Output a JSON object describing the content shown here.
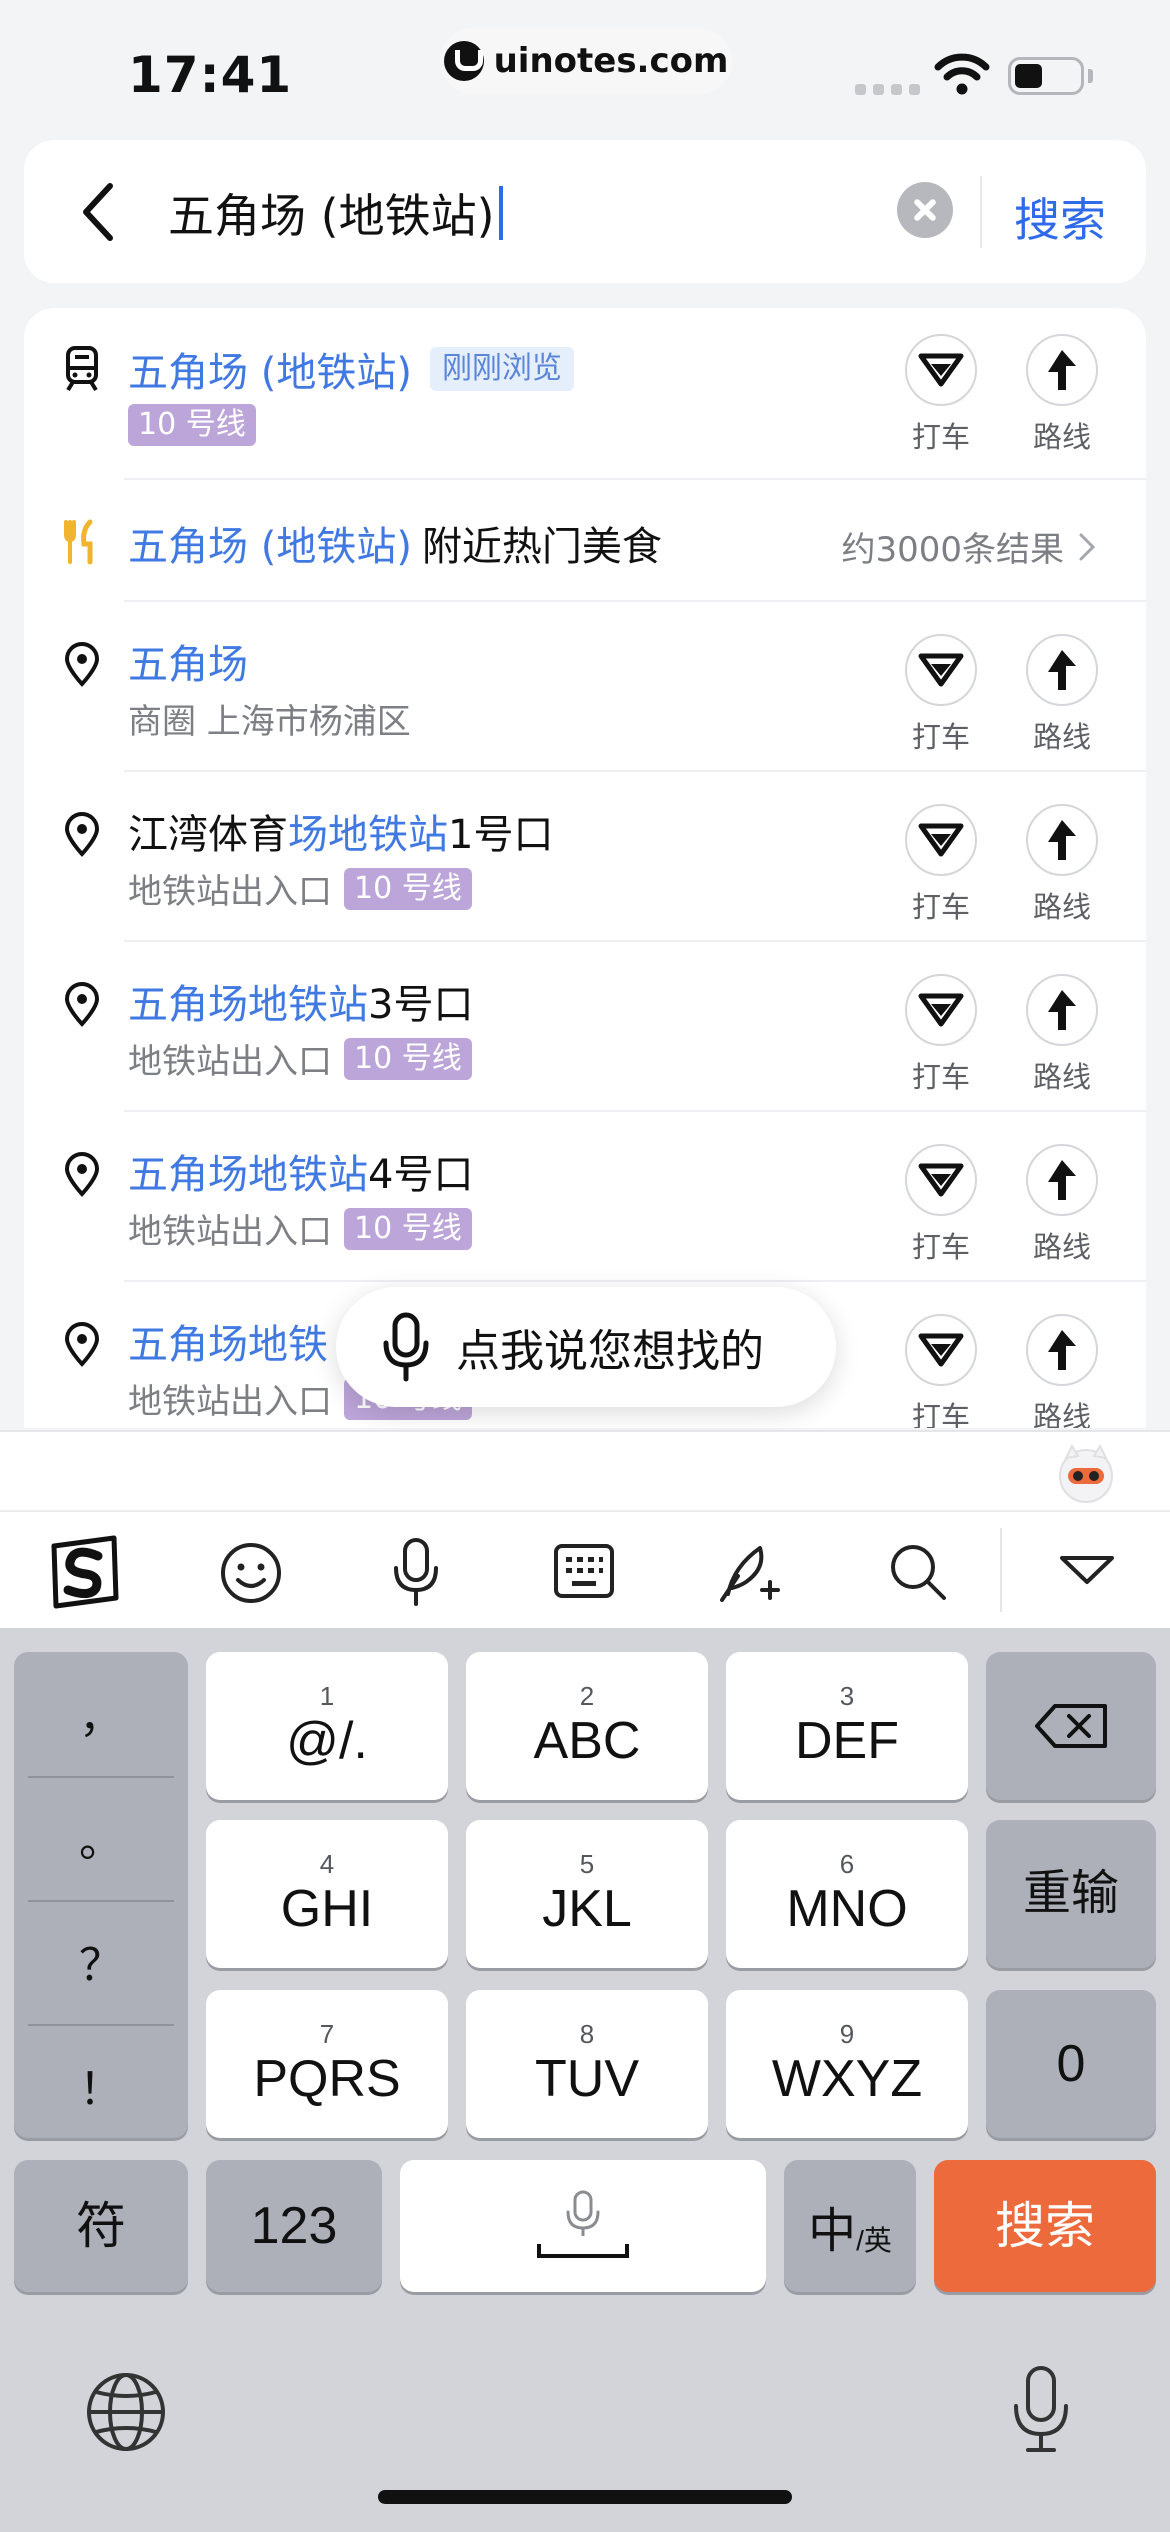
{
  "status_bar": {
    "time": "17:41",
    "watermark": "uinotes.com"
  },
  "search": {
    "query": "五角场 (地铁站)",
    "search_label": "搜索"
  },
  "actions": {
    "taxi": "打车",
    "route": "路线"
  },
  "results": [
    {
      "title_hl": "五角场 (地铁站)",
      "title_rest": "",
      "recent": "刚刚浏览",
      "sub": "",
      "badge": "10 号线",
      "icon": "metro-icon"
    },
    {
      "title_hl": "五角场 (地铁站)",
      "title_rest": "附近热门美食",
      "count": "约3000条结果",
      "icon": "food-icon"
    },
    {
      "title_hl": "五角场",
      "title_rest": "",
      "sub": "商圈 上海市杨浦区",
      "badge": "",
      "icon": "location-pin-icon"
    },
    {
      "title_pre": "江湾体育",
      "title_hl": "场地铁站",
      "title_rest": "1号口",
      "sub": "地铁站出入口",
      "badge": "10 号线",
      "icon": "location-pin-icon"
    },
    {
      "title_hl": "五角场地铁站",
      "title_rest": "3号口",
      "sub": "地铁站出入口",
      "badge": "10 号线",
      "icon": "location-pin-icon"
    },
    {
      "title_hl": "五角场地铁站",
      "title_rest": "4号口",
      "sub": "地铁站出入口",
      "badge": "10 号线",
      "icon": "location-pin-icon"
    },
    {
      "title_hl": "五角场地铁",
      "title_rest": "",
      "sub": "地铁站出入口",
      "badge": "10 号线",
      "icon": "location-pin-icon"
    }
  ],
  "voice_prompt": "点我说您想找的",
  "keyboard": {
    "punctuation": [
      "，",
      "。",
      "？",
      "！"
    ],
    "keys": [
      {
        "num": "1",
        "label": "@/."
      },
      {
        "num": "2",
        "label": "ABC"
      },
      {
        "num": "3",
        "label": "DEF"
      },
      {
        "num": "4",
        "label": "GHI"
      },
      {
        "num": "5",
        "label": "JKL"
      },
      {
        "num": "6",
        "label": "MNO"
      },
      {
        "num": "7",
        "label": "PQRS"
      },
      {
        "num": "8",
        "label": "TUV"
      },
      {
        "num": "9",
        "label": "WXYZ"
      }
    ],
    "retype": "重输",
    "zero": "0",
    "symbols": "符",
    "numbers": "123",
    "lang_main": "中",
    "lang_alt": "/英",
    "search": "搜索"
  },
  "colors": {
    "accent": "#4179e3",
    "line10": "#bca5d9",
    "search_key": "#ec6a3c"
  }
}
